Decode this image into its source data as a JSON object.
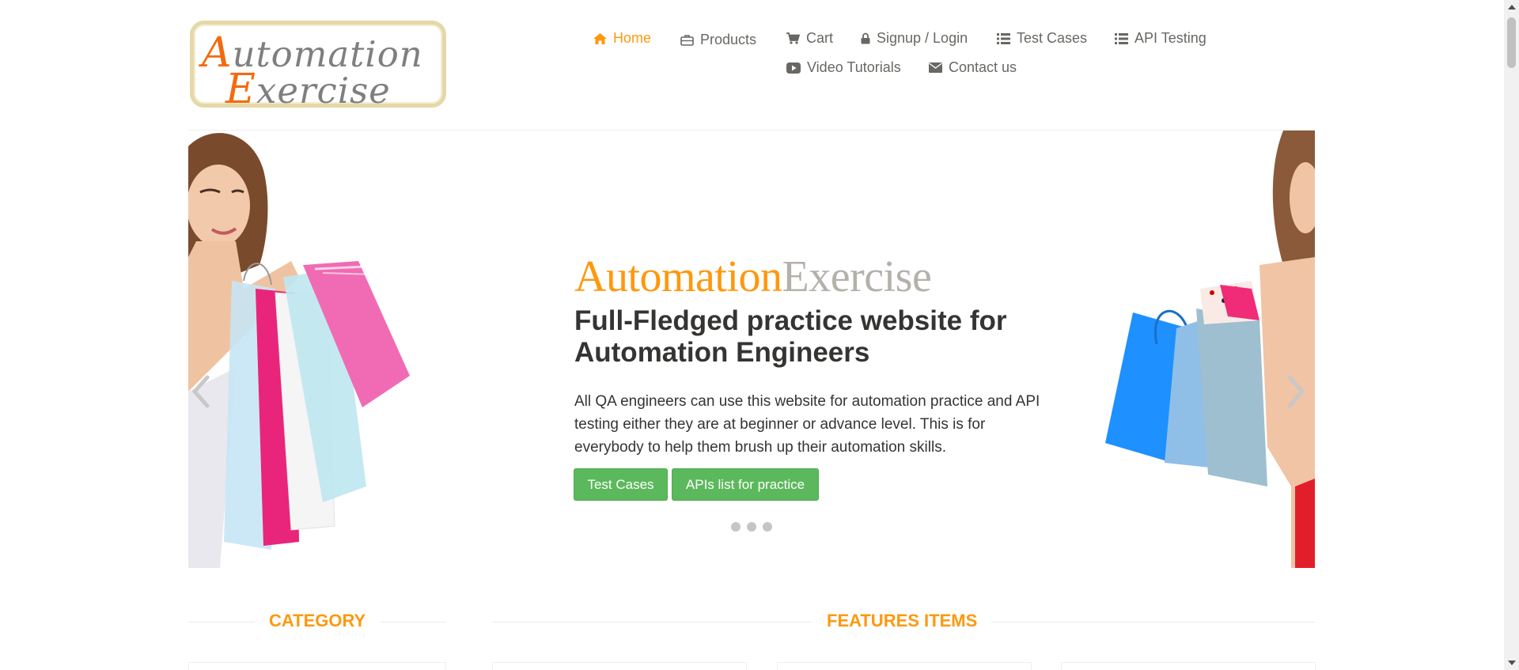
{
  "logo": {
    "line1_first": "A",
    "line1_rest": "utomation",
    "line2_first": "E",
    "line2_rest": "xercise"
  },
  "nav": {
    "items": [
      {
        "label": "Home",
        "icon": "home-icon",
        "active": true
      },
      {
        "label": "Products",
        "icon": "briefcase-icon"
      },
      {
        "label": "Cart",
        "icon": "cart-icon"
      },
      {
        "label": "Signup / Login",
        "icon": "lock-icon"
      },
      {
        "label": "Test Cases",
        "icon": "list-icon"
      },
      {
        "label": "API Testing",
        "icon": "list-icon"
      },
      {
        "label": "Video Tutorials",
        "icon": "youtube-play-icon"
      },
      {
        "label": "Contact us",
        "icon": "envelope-icon"
      }
    ]
  },
  "hero": {
    "brand_part1": "Automation",
    "brand_part2": "Exercise",
    "headline": "Full-Fledged practice website for Automation Engineers",
    "description": "All QA engineers can use this website for automation practice and API testing either they are at beginner or advance level. This is for everybody to help them brush up their automation skills.",
    "button_test_cases": "Test Cases",
    "button_apis": "APIs list for practice",
    "slide_count": 3
  },
  "sections": {
    "category_title": "CATEGORY",
    "features_title": "FEATURES ITEMS"
  },
  "colors": {
    "accent": "#fe980f",
    "button_green": "#5cb85c",
    "text_dark": "#363432",
    "nav_text": "#696763"
  }
}
